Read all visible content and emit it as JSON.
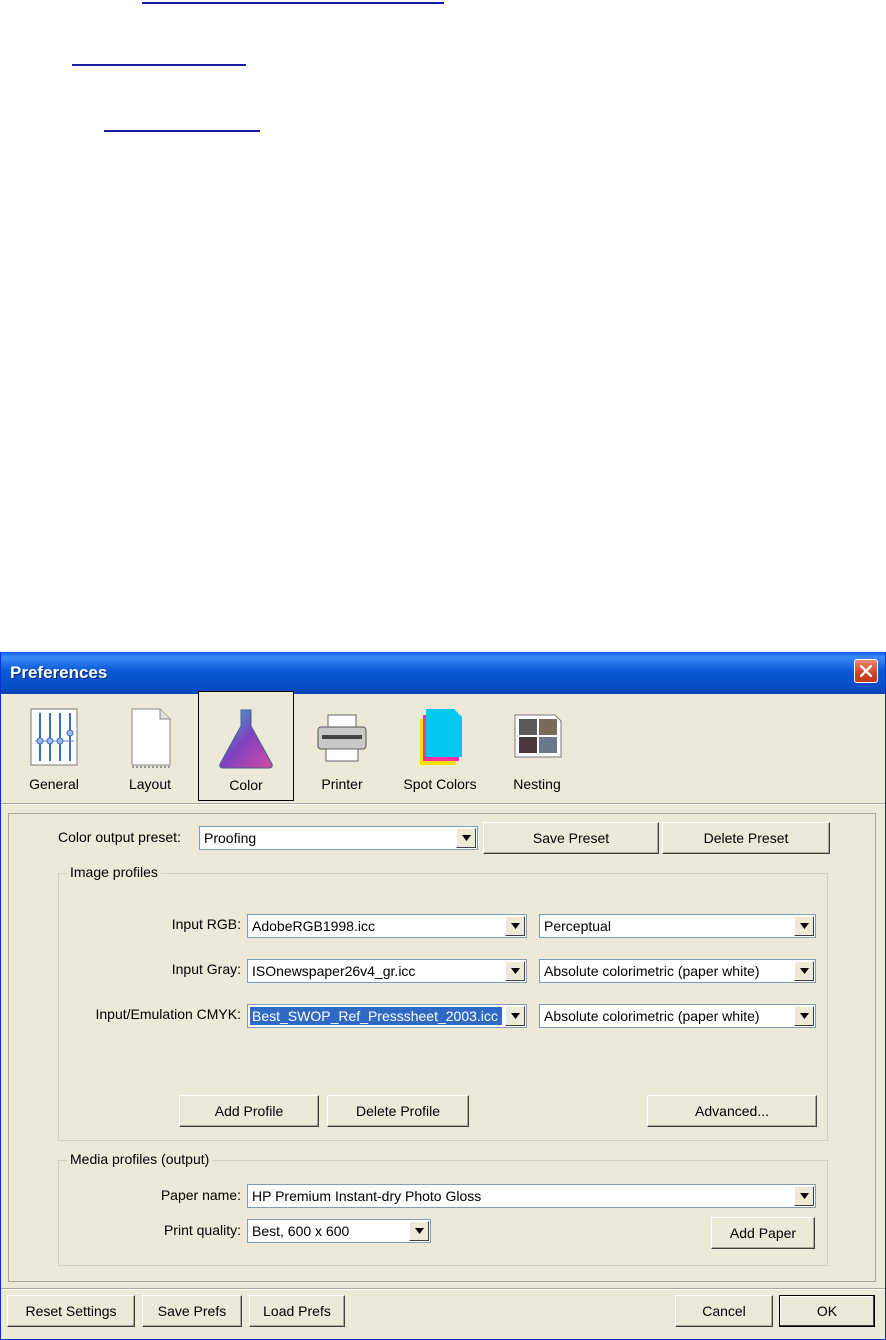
{
  "dialog": {
    "title": "Preferences",
    "toolbar": [
      {
        "label": "General",
        "icon": "sliders-icon",
        "selected": false
      },
      {
        "label": "Layout",
        "icon": "page-icon",
        "selected": false
      },
      {
        "label": "Color",
        "icon": "flask-icon",
        "selected": true
      },
      {
        "label": "Printer",
        "icon": "printer-icon",
        "selected": false
      },
      {
        "label": "Spot Colors",
        "icon": "spot-colors-icon",
        "selected": false
      },
      {
        "label": "Nesting",
        "icon": "nesting-icon",
        "selected": false
      }
    ],
    "color_output_preset": {
      "label": "Color output preset:",
      "value": "Proofing",
      "save_button": "Save Preset",
      "delete_button": "Delete Preset"
    },
    "image_profiles": {
      "title": "Image profiles",
      "rows": [
        {
          "label": "Input RGB:",
          "profile": "AdobeRGB1998.icc",
          "intent": "Perceptual"
        },
        {
          "label": "Input Gray:",
          "profile": "ISOnewspaper26v4_gr.icc",
          "intent": "Absolute colorimetric (paper white)"
        },
        {
          "label": "Input/Emulation CMYK:",
          "profile": "Best_SWOP_Ref_Presssheet_2003.icc",
          "intent": "Absolute colorimetric (paper white)"
        }
      ],
      "add_profile_button": "Add Profile",
      "delete_profile_button": "Delete Profile",
      "advanced_button": "Advanced..."
    },
    "media_profiles": {
      "title": "Media profiles (output)",
      "paper_name_label": "Paper name:",
      "paper_name": "HP Premium Instant-dry Photo Gloss",
      "print_quality_label": "Print quality:",
      "print_quality": "Best, 600 x 600",
      "add_paper_button": "Add Paper"
    },
    "footer": {
      "reset_button": "Reset Settings",
      "save_prefs_button": "Save Prefs",
      "load_prefs_button": "Load Prefs",
      "cancel_button": "Cancel",
      "ok_button": "OK"
    }
  },
  "colors": {
    "title_bar": "#0a58d8",
    "dialog_bg": "#ece9d8",
    "selection": "#316ac5",
    "link_underline": "#1a1aa8"
  }
}
